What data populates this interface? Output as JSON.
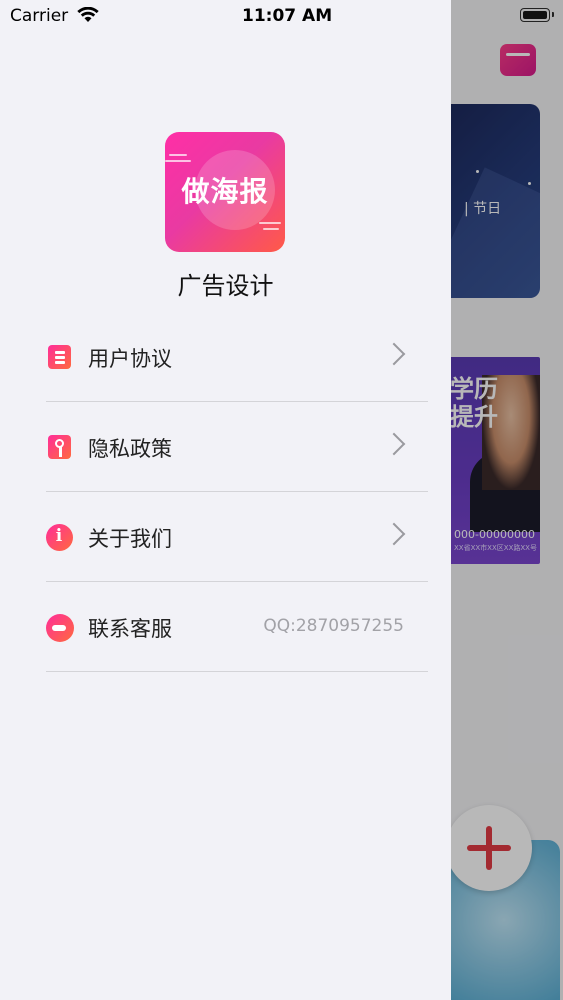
{
  "status_bar": {
    "carrier": "Carrier",
    "time": "11:07 AM"
  },
  "drawer": {
    "app_icon_text": "做海报",
    "app_name": "广告设计",
    "menu": [
      {
        "label": "用户协议",
        "icon": "document-icon",
        "chevron": true
      },
      {
        "label": "隐私政策",
        "icon": "key-icon",
        "chevron": true
      },
      {
        "label": "关于我们",
        "icon": "info-icon",
        "chevron": true
      },
      {
        "label": "联系客服",
        "icon": "chat-icon",
        "value": "QQ:2870957255"
      }
    ]
  },
  "background": {
    "card_dark_text": "| 节日",
    "card_purple_title": "学历\n提升",
    "card_purple_phone": "000-00000000",
    "card_purple_address": "XX省XX市XX区XX路XX号"
  },
  "colors": {
    "accent_start": "#ff2d9a",
    "accent_end": "#ff6a3d",
    "fab_plus": "#e23b45",
    "drawer_bg": "#f2f2f7"
  }
}
